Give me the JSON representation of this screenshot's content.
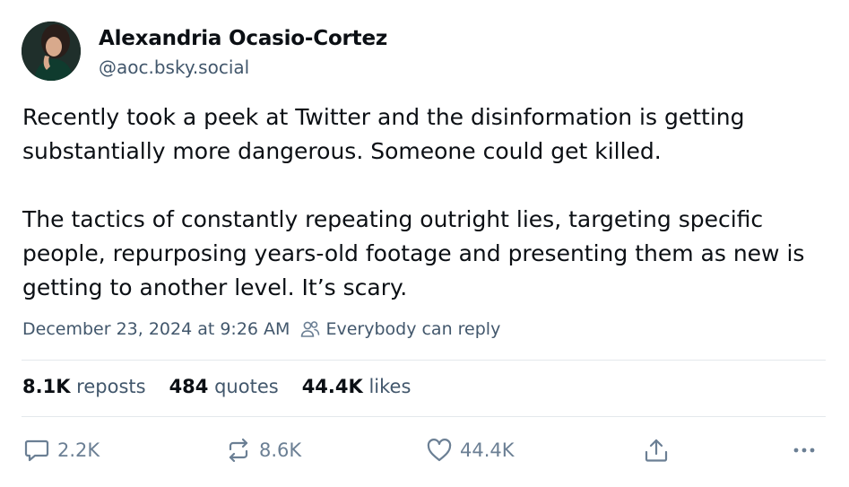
{
  "author": {
    "name": "Alexandria Ocasio-Cortez",
    "handle": "@aoc.bsky.social"
  },
  "post": {
    "paragraphs": [
      "Recently took a peek at Twitter and the disinformation is getting substantially more dangerous. Someone could get killed.",
      "The tactics of constantly repeating outright lies, targeting specific people, repurposing years-old footage and presenting them as new is getting to another level. It’s scary."
    ],
    "timestamp": "December 23, 2024 at 9:26 AM",
    "reply_setting": "Everybody can reply"
  },
  "stats": {
    "reposts_count": "8.1K",
    "reposts_label": "reposts",
    "quotes_count": "484",
    "quotes_label": "quotes",
    "likes_count": "44.4K",
    "likes_label": "likes"
  },
  "actions": {
    "reply_count": "2.2K",
    "repost_count": "8.6K",
    "like_count": "44.4K"
  },
  "colors": {
    "text": "#0b0f14",
    "muted": "#42576c",
    "icon": "#6b7f94",
    "divider": "#e4e8ec"
  }
}
